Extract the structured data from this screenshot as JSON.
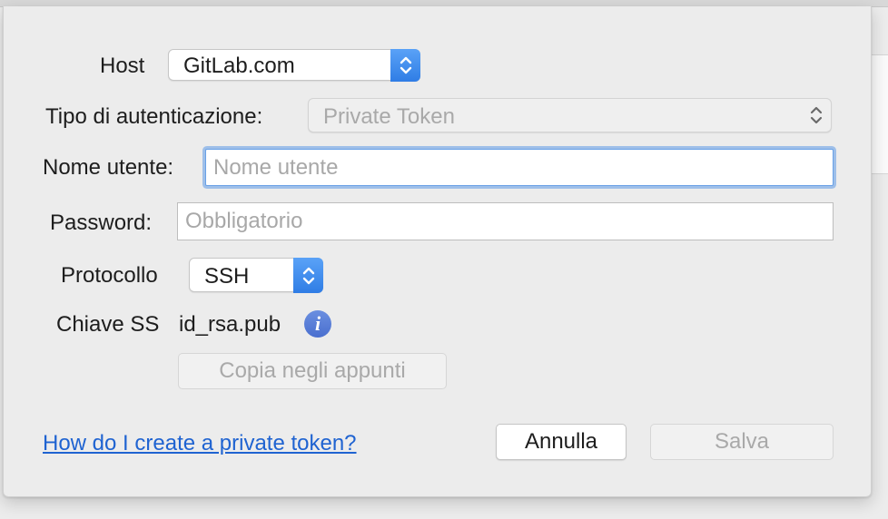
{
  "form": {
    "host_label": "Host",
    "host_value": "GitLab.com",
    "auth_label": "Tipo di autenticazione:",
    "auth_value": "Private Token",
    "username_label": "Nome utente:",
    "username_placeholder": "Nome utente",
    "password_label": "Password:",
    "password_placeholder": "Obbligatorio",
    "protocol_label": "Protocollo",
    "protocol_value": "SSH",
    "ssh_key_label": "Chiave SS",
    "ssh_key_value": "id_rsa.pub",
    "copy_button": "Copia negli appunti"
  },
  "footer": {
    "help_link": "How do I create a private token?",
    "cancel_button": "Annulla",
    "save_button": "Salva"
  },
  "icons": {
    "info": "info-icon",
    "stepper": "chevron-up-down-icon"
  },
  "colors": {
    "accent": "#2f7de5",
    "link": "#1f63d1",
    "focus_ring": "#5f9be8"
  }
}
